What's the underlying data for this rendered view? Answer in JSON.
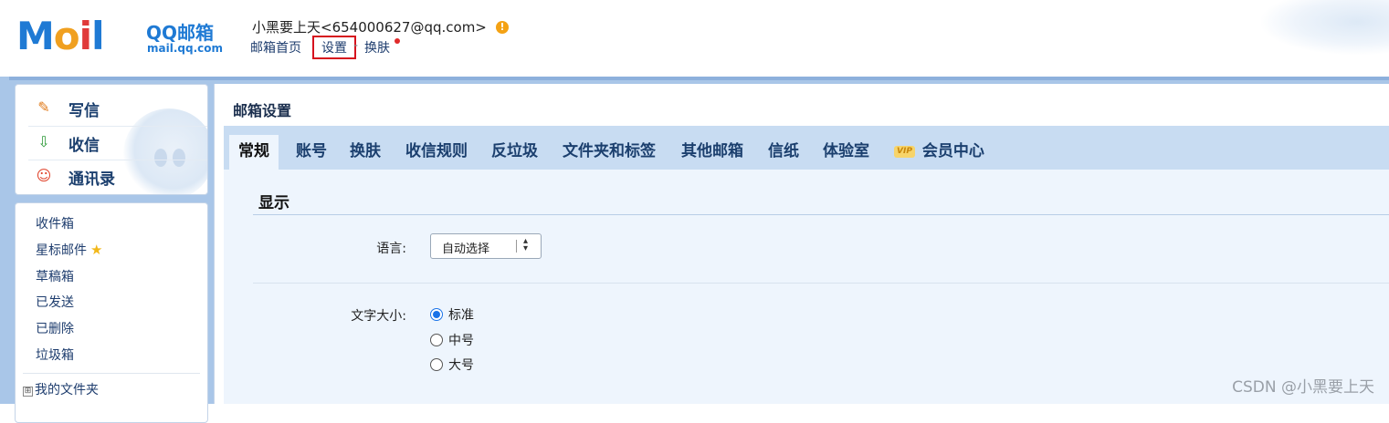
{
  "header": {
    "logo": {
      "word_m": "M",
      "word_o": "o",
      "word_i": "i",
      "word_l": "l",
      "qq_label": "QQ邮箱",
      "domain": "mail.qq.com"
    },
    "user_line": "小黑要上天<654000627@qq.com>",
    "warning_icon": "!",
    "links": {
      "home": "邮箱首页",
      "settings": "设置",
      "separator": "-",
      "skin": "换肤"
    }
  },
  "sidebar": {
    "quick_actions": [
      {
        "label": "写信",
        "icon": "✎",
        "icon_name": "compose-icon"
      },
      {
        "label": "收信",
        "icon": "⇩",
        "icon_name": "receive-icon"
      },
      {
        "label": "通讯录",
        "icon": "☺",
        "icon_name": "contacts-icon"
      }
    ],
    "folders": [
      "收件箱",
      "星标邮件",
      "草稿箱",
      "已发送",
      "已删除",
      "垃圾箱"
    ],
    "star_icon": "★",
    "my_folders_toggle": "⊞",
    "my_folders": "我的文件夹"
  },
  "main": {
    "title": "邮箱设置",
    "tabs": [
      {
        "label": "常规",
        "active": true
      },
      {
        "label": "账号"
      },
      {
        "label": "换肤"
      },
      {
        "label": "收信规则"
      },
      {
        "label": "反垃圾"
      },
      {
        "label": "文件夹和标签"
      },
      {
        "label": "其他邮箱"
      },
      {
        "label": "信纸"
      },
      {
        "label": "体验室"
      },
      {
        "label": "会员中心",
        "badge": "VIP"
      }
    ],
    "section_title": "显示",
    "language": {
      "label": "语言:",
      "value": "自动选择",
      "arrow": "▲▼"
    },
    "font_size": {
      "label": "文字大小:",
      "options": [
        {
          "label": "标准",
          "checked": true
        },
        {
          "label": "中号",
          "checked": false
        },
        {
          "label": "大号",
          "checked": false
        }
      ]
    }
  },
  "watermark": "CSDN @小黑要上天",
  "colors": {
    "brand_blue": "#1f7ad4",
    "tab_bar": "#c8dcf2",
    "content_bg": "#eef5fd",
    "highlight_border": "#d6121e"
  }
}
